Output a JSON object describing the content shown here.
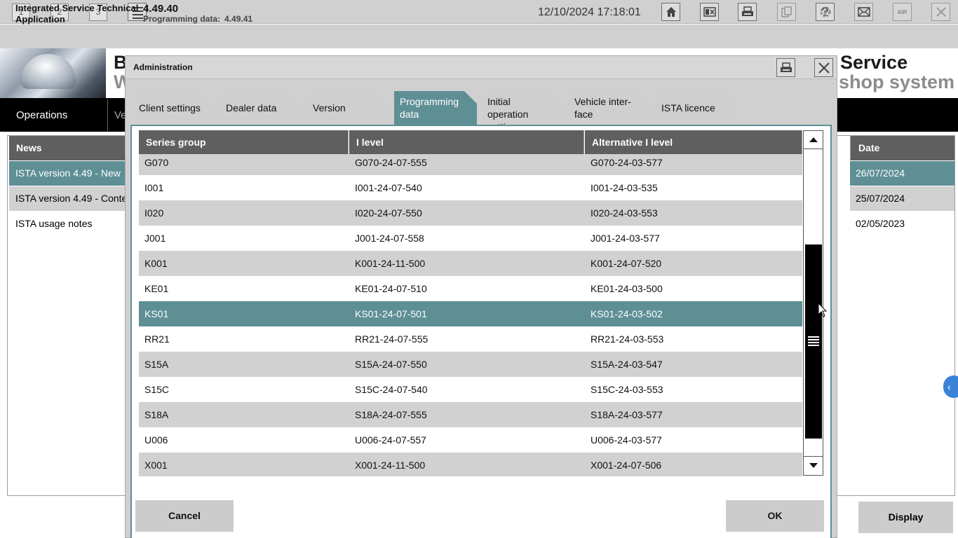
{
  "toolbar": {
    "workspaces": [
      "1",
      "2",
      "3"
    ],
    "datetime": "12/10/2024 17:18:01",
    "icons": [
      "list-icon",
      "home-icon",
      "card-reader-icon",
      "printer-icon",
      "wrench-icon",
      "help-icon",
      "download-icon",
      "window-icon",
      "close-icon"
    ]
  },
  "app": {
    "title": "Integrated Service Technical Application",
    "version": "4.49.40",
    "programming_data_label": "Programming data:",
    "programming_data_value": "4.49.41"
  },
  "background": {
    "title_left_1": "B",
    "title_left_2": "W",
    "title_right_1": "Service",
    "title_right_2": "shop system",
    "nav_operations": "Operations",
    "nav_vehicle_partial": "Ve",
    "news_header": "News",
    "date_header": "Date",
    "news": [
      {
        "title": "ISTA version 4.49 - New",
        "date": "26/07/2024",
        "highlighted": true
      },
      {
        "title": "ISTA version 4.49 - Conte",
        "date": "25/07/2024",
        "highlighted": false
      },
      {
        "title": "ISTA usage notes",
        "date": "02/05/2023",
        "highlighted": false
      }
    ],
    "display_button": "Display",
    "edge_tab_glyph": "‹"
  },
  "dialog": {
    "title": "Administration",
    "tabs": [
      {
        "label": "Client settings",
        "active": false
      },
      {
        "label": "Dealer data",
        "active": false
      },
      {
        "label": "Version",
        "active": false
      },
      {
        "label": "Programming data",
        "active": true
      },
      {
        "label": "Initial operation settings",
        "active": false
      },
      {
        "label": "Vehicle inter-face",
        "active": false
      },
      {
        "label": "ISTA licence",
        "active": false
      }
    ],
    "columns": [
      "Series group",
      "I level",
      "Alternative I level"
    ],
    "rows": [
      {
        "series": "G070",
        "ilevel": "G070-24-07-555",
        "alt": "G070-24-03-577"
      },
      {
        "series": "I001",
        "ilevel": "I001-24-07-540",
        "alt": "I001-24-03-535"
      },
      {
        "series": "I020",
        "ilevel": "I020-24-07-550",
        "alt": "I020-24-03-553"
      },
      {
        "series": "J001",
        "ilevel": "J001-24-07-558",
        "alt": "J001-24-03-577"
      },
      {
        "series": "K001",
        "ilevel": "K001-24-11-500",
        "alt": "K001-24-07-520"
      },
      {
        "series": "KE01",
        "ilevel": "KE01-24-07-510",
        "alt": "KE01-24-03-500"
      },
      {
        "series": "KS01",
        "ilevel": "KS01-24-07-501",
        "alt": "KS01-24-03-502"
      },
      {
        "series": "RR21",
        "ilevel": "RR21-24-07-555",
        "alt": "RR21-24-03-553"
      },
      {
        "series": "S15A",
        "ilevel": "S15A-24-07-550",
        "alt": "S15A-24-03-547"
      },
      {
        "series": "S15C",
        "ilevel": "S15C-24-07-540",
        "alt": "S15C-24-03-553"
      },
      {
        "series": "S18A",
        "ilevel": "S18A-24-07-555",
        "alt": "S18A-24-03-577"
      },
      {
        "series": "U006",
        "ilevel": "U006-24-07-557",
        "alt": "U006-24-03-577"
      },
      {
        "series": "X001",
        "ilevel": "X001-24-11-500",
        "alt": "X001-24-07-506"
      }
    ],
    "selected_series": "KS01",
    "cancel": "Cancel",
    "ok": "OK"
  },
  "colors": {
    "accent": "#5e8f95",
    "header_grey": "#5f5f5f",
    "row_grey": "#d1d1d1",
    "toolbar_grey": "#d0d0d0"
  }
}
